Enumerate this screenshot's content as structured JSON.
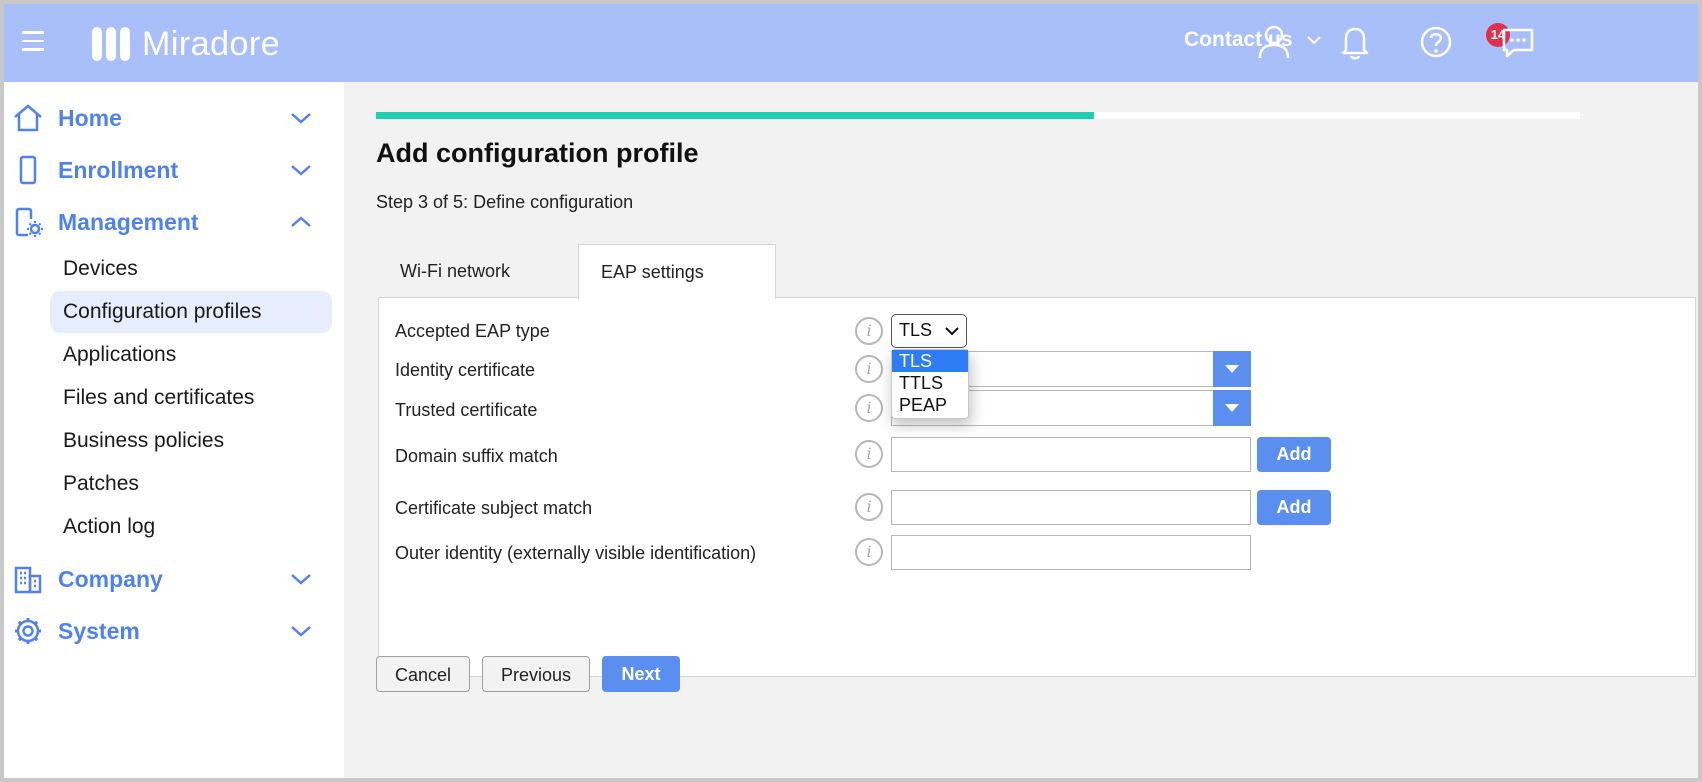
{
  "colors": {
    "topbar": "#a9bffa",
    "accent": "#4f82f0",
    "button": "#5a8ff0",
    "progress_done": "#1fcfb0",
    "badge": "#e03050"
  },
  "header": {
    "brand": "Miradore",
    "contact_label": "Contact us",
    "notification_count": "14",
    "icons": [
      "menu-icon",
      "user-icon",
      "bell-icon",
      "help-icon",
      "chat-icon"
    ]
  },
  "sidebar": {
    "home": "Home",
    "enrollment": "Enrollment",
    "management": "Management",
    "management_items": [
      "Devices",
      "Configuration profiles",
      "Applications",
      "Files and certificates",
      "Business policies",
      "Patches",
      "Action log"
    ],
    "active_item": "Configuration profiles",
    "company": "Company",
    "system": "System"
  },
  "wizard": {
    "title": "Add configuration profile",
    "step_text": "Step 3 of 5: Define configuration",
    "current_step": 3,
    "total_steps": 5
  },
  "tabs": {
    "wifi": "Wi-Fi network",
    "eap": "EAP settings",
    "active": "EAP settings"
  },
  "form": {
    "eap_type_label": "Accepted EAP type",
    "eap_type_value": "TLS",
    "eap_options": [
      "TLS",
      "TTLS",
      "PEAP"
    ],
    "identity_cert_label": "Identity certificate",
    "trusted_cert_label": "Trusted certificate",
    "domain_suffix_label": "Domain suffix match",
    "domain_suffix_value": "",
    "cert_subject_label": "Certificate subject match",
    "cert_subject_value": "",
    "outer_identity_label": "Outer identity (externally visible identification)",
    "outer_identity_value": "",
    "add_label": "Add",
    "info_glyph": "i"
  },
  "footer": {
    "cancel": "Cancel",
    "previous": "Previous",
    "next": "Next"
  }
}
